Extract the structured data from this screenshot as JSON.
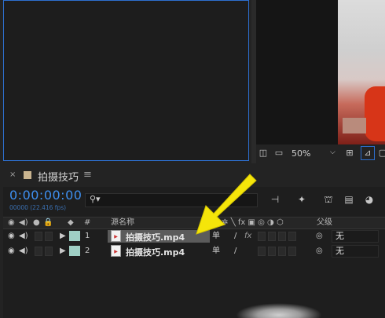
{
  "viewer": {
    "zoom": "50%"
  },
  "timeline": {
    "tab_label": "拍摄技巧",
    "timecode": "0:00:00:00",
    "fps_readout": "00000 (22.416 fps)",
    "search_placeholder": ""
  },
  "columns": {
    "number": "#",
    "source_name": "源名称",
    "parent": "父级"
  },
  "layers": [
    {
      "index": "1",
      "name": "拍摄技巧.mp4",
      "parent": "无",
      "switch1": "单",
      "switch2": "/",
      "switch3": "fx"
    },
    {
      "index": "2",
      "name": "拍摄技巧.mp4",
      "parent": "无",
      "switch1": "单",
      "switch2": "/"
    }
  ],
  "colors": {
    "accent": "#3e8ff0",
    "label": "#9fcfc4",
    "arrow": "#f5e50a"
  },
  "icons": [
    "eye-icon",
    "speaker-icon",
    "solo-icon",
    "lock-icon",
    "tag-icon",
    "search-icon",
    "graph-icon",
    "parent-pickwhip-icon"
  ]
}
